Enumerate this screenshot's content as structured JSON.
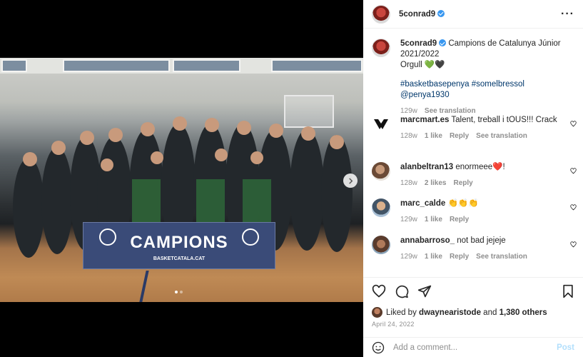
{
  "post": {
    "username": "5conrad9",
    "verified": true,
    "caption_line1": "Campions de Catalunya Júnior 2021/2022",
    "caption_line2": "Orgull 💚🖤",
    "hashtags": [
      "#basketbasepenya",
      "#somelbressol",
      "@penya1930"
    ],
    "time": "129w",
    "see_translation": "See translation"
  },
  "media": {
    "banner_text": "CAMPIONS",
    "banner_sub": "BASKETCATALA.CAT",
    "slide_count": 2,
    "active_slide": 0
  },
  "comments": [
    {
      "user": "marcmart.es",
      "text": "Talent, treball i tOUS!!! Crack",
      "time": "128w",
      "likes": "1 like",
      "reply": "Reply",
      "translate": "See translation"
    },
    {
      "user": "alanbeltran13",
      "text": "enormeee❤️!",
      "time": "128w",
      "likes": "2 likes",
      "reply": "Reply",
      "translate": ""
    },
    {
      "user": "marc_calde",
      "text": "👏👏👏",
      "time": "129w",
      "likes": "1 like",
      "reply": "Reply",
      "translate": ""
    },
    {
      "user": "annabarroso_",
      "text": "not bad jejeje",
      "time": "129w",
      "likes": "1 like",
      "reply": "Reply",
      "translate": "See translation"
    }
  ],
  "likes": {
    "prefix": "Liked by",
    "user": "dwaynearistode",
    "and": "and",
    "others": "1,380 others"
  },
  "date": "April 24, 2022",
  "add_comment": {
    "placeholder": "Add a comment...",
    "post_label": "Post"
  },
  "colors": {
    "link": "#00376b",
    "verified": "#3897f0",
    "muted": "#8e8e8e",
    "post_disabled": "#b2dffc"
  }
}
